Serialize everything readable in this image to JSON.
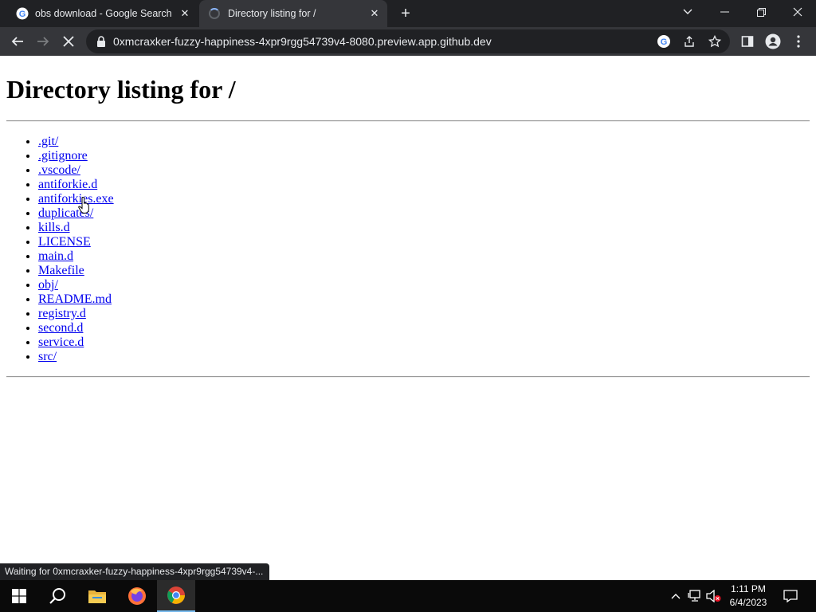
{
  "browser": {
    "tabs": [
      {
        "title": "obs download - Google Search",
        "favicon": "google-icon",
        "active": false
      },
      {
        "title": "Directory listing for /",
        "favicon": "loading-spinner-icon",
        "active": true
      }
    ],
    "url": "0xmcraxker-fuzzy-happiness-4xpr9rgg54739v4-8080.preview.app.github.dev",
    "status_text": "Waiting for 0xmcraxker-fuzzy-happiness-4xpr9rgg54739v4-..."
  },
  "page": {
    "heading": "Directory listing for /",
    "entries": [
      ".git/",
      ".gitignore",
      ".vscode/",
      "antiforkie.d",
      "antiforkies.exe",
      "duplicates/",
      "kills.d",
      "LICENSE",
      "main.d",
      "Makefile",
      "obj/",
      "README.md",
      "registry.d",
      "second.d",
      "service.d",
      "src/"
    ]
  },
  "taskbar": {
    "time": "1:11 PM",
    "date": "6/4/2023",
    "apps": [
      "start-icon",
      "search-icon",
      "file-explorer-icon",
      "firefox-icon",
      "chrome-icon"
    ]
  },
  "colors": {
    "link": "#0000ee",
    "tab_bar": "#202124",
    "toolbar": "#35363a",
    "taskbar": "#0a0a0a"
  }
}
